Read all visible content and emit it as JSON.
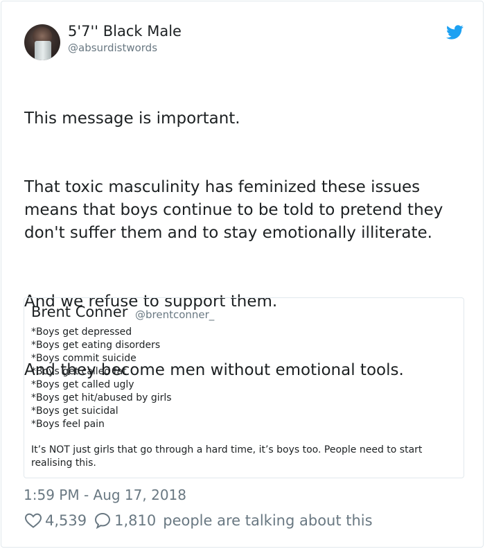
{
  "author": {
    "display_name": "5'7'' Black Male",
    "handle": "@absurdistwords"
  },
  "icons": {
    "brand": "twitter-bird-icon",
    "like": "heart-outline-icon",
    "reply": "speech-bubble-icon",
    "brand_color": "#1da1f2"
  },
  "tweet": {
    "paragraphs": [
      "This message is important.",
      "That toxic masculinity has feminized these issues means that boys continue to be told to pretend they don't suffer them and to stay emotionally illiterate.",
      "And we refuse to support them.",
      "And they become men without emotional tools."
    ]
  },
  "quote": {
    "display_name": "Brent Conner",
    "handle": "@brentconner_",
    "lines": [
      "*Boys get depressed",
      "*Boys get eating disorders",
      "*Boys commit suicide",
      "*Boys get called fat",
      "*Boys get called ugly",
      "*Boys get hit/abused by girls",
      "*Boys get suicidal",
      "*Boys feel pain"
    ],
    "footer": "It’s NOT just girls that go through a hard time, it’s boys too. People need to start realising this."
  },
  "meta": {
    "timestamp": "1:59 PM - Aug 17, 2018",
    "likes": "4,539",
    "replies": "1,810",
    "talking_label": "people are talking about this"
  }
}
